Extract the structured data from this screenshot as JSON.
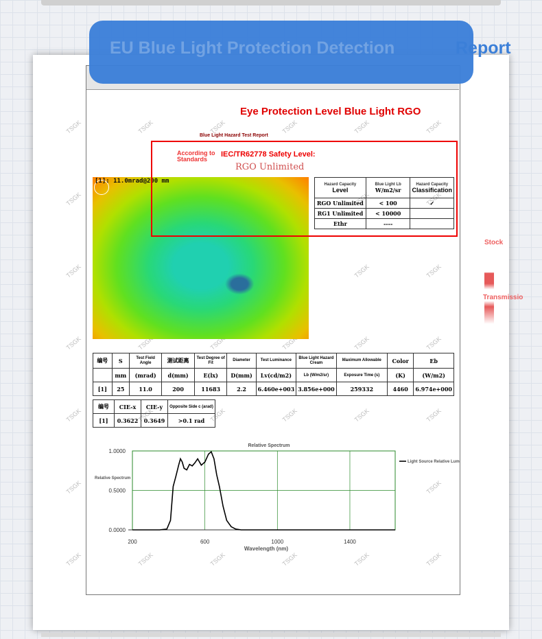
{
  "banner": {
    "title_faded": "EU Blue Light Protection Detection",
    "title_tail": "Report"
  },
  "report": {
    "heading": "Eye Protection Level Blue Light RGO",
    "caption": "Blue Light Hazard Test Report",
    "standard_label": "According to Standards",
    "safety_level": "IEC/TR62778 Safety Level:",
    "stamp": "RGO Unlimited",
    "heatmap_label": "[1]:  11.0mrad@200 mm"
  },
  "hazard_table": {
    "header": [
      "Hazard Capacity Level",
      "Blue Light Lb W/m2/sr",
      "Hazard Capacity Classification"
    ],
    "header_small": [
      "Hazard Capacity",
      "Blue Light Lb",
      "Hazard Capacity"
    ],
    "header_big": [
      "Level",
      "W/m2/sr",
      "Classification"
    ],
    "rows": [
      [
        "RGO Unlimited",
        "< 100",
        "✓"
      ],
      [
        "RG1 Unlimited",
        "< 10000",
        ""
      ],
      [
        "Ethr",
        "----",
        ""
      ]
    ]
  },
  "data_table": {
    "header_top": [
      "编号",
      "S",
      "Test Field Angle",
      "测试距离",
      "Test Degree of Fit",
      "Diameter",
      "Test Luminance",
      "Blue Light Hazard Cream",
      "Maximum Allowable",
      "Color",
      "Eb"
    ],
    "header_units": [
      "",
      "mm",
      "(mrad)",
      "d(mm)",
      "E(lx)",
      "D(mm)",
      "Lv(cd/m2)",
      "Lb (W/m2/sr)",
      "Exposure Time (s)",
      "(K)",
      "(W/m2)"
    ],
    "row": [
      "[1]",
      "25",
      "11.0",
      "200",
      "11683",
      "2.2",
      "6.460e+003",
      "3.856e+000",
      "259332",
      "4460",
      "6.974e+000"
    ]
  },
  "cie_table": {
    "header": [
      "编号",
      "CIE-x",
      "CIE-y",
      "Opposite Side c (arad)"
    ],
    "row": [
      "[1]",
      "0.3622",
      "0.3649",
      ">0.1 rad"
    ]
  },
  "chart_data": {
    "type": "line",
    "title": "Relative Spectrum",
    "xlabel": "Wavelength (nm)",
    "ylabel": "Relative Spectrum",
    "legend": "Light Source Relative Lumens",
    "xlim": [
      200,
      1650
    ],
    "ylim": [
      0,
      1.0
    ],
    "x_ticks": [
      "200",
      "600",
      "1000",
      "1400"
    ],
    "y_ticks": [
      "0.0000",
      "0.5000",
      "1.0000"
    ],
    "series": [
      {
        "x": [
          200,
          350,
          390,
          410,
          425,
          440,
          455,
          465,
          475,
          485,
          500,
          515,
          530,
          545,
          560,
          580,
          600,
          620,
          635,
          650,
          665,
          680,
          700,
          720,
          745,
          770,
          800,
          850,
          900,
          1000,
          1650
        ],
        "y": [
          0,
          0,
          0.01,
          0.12,
          0.55,
          0.68,
          0.82,
          0.9,
          0.86,
          0.78,
          0.76,
          0.83,
          0.81,
          0.85,
          0.9,
          0.82,
          0.86,
          0.96,
          0.99,
          0.9,
          0.7,
          0.55,
          0.3,
          0.12,
          0.04,
          0.01,
          0,
          0,
          0,
          0,
          0
        ]
      }
    ]
  },
  "side_labels": {
    "stock": "Stock",
    "transmission": "Transmissio"
  },
  "watermark": "TSGK"
}
